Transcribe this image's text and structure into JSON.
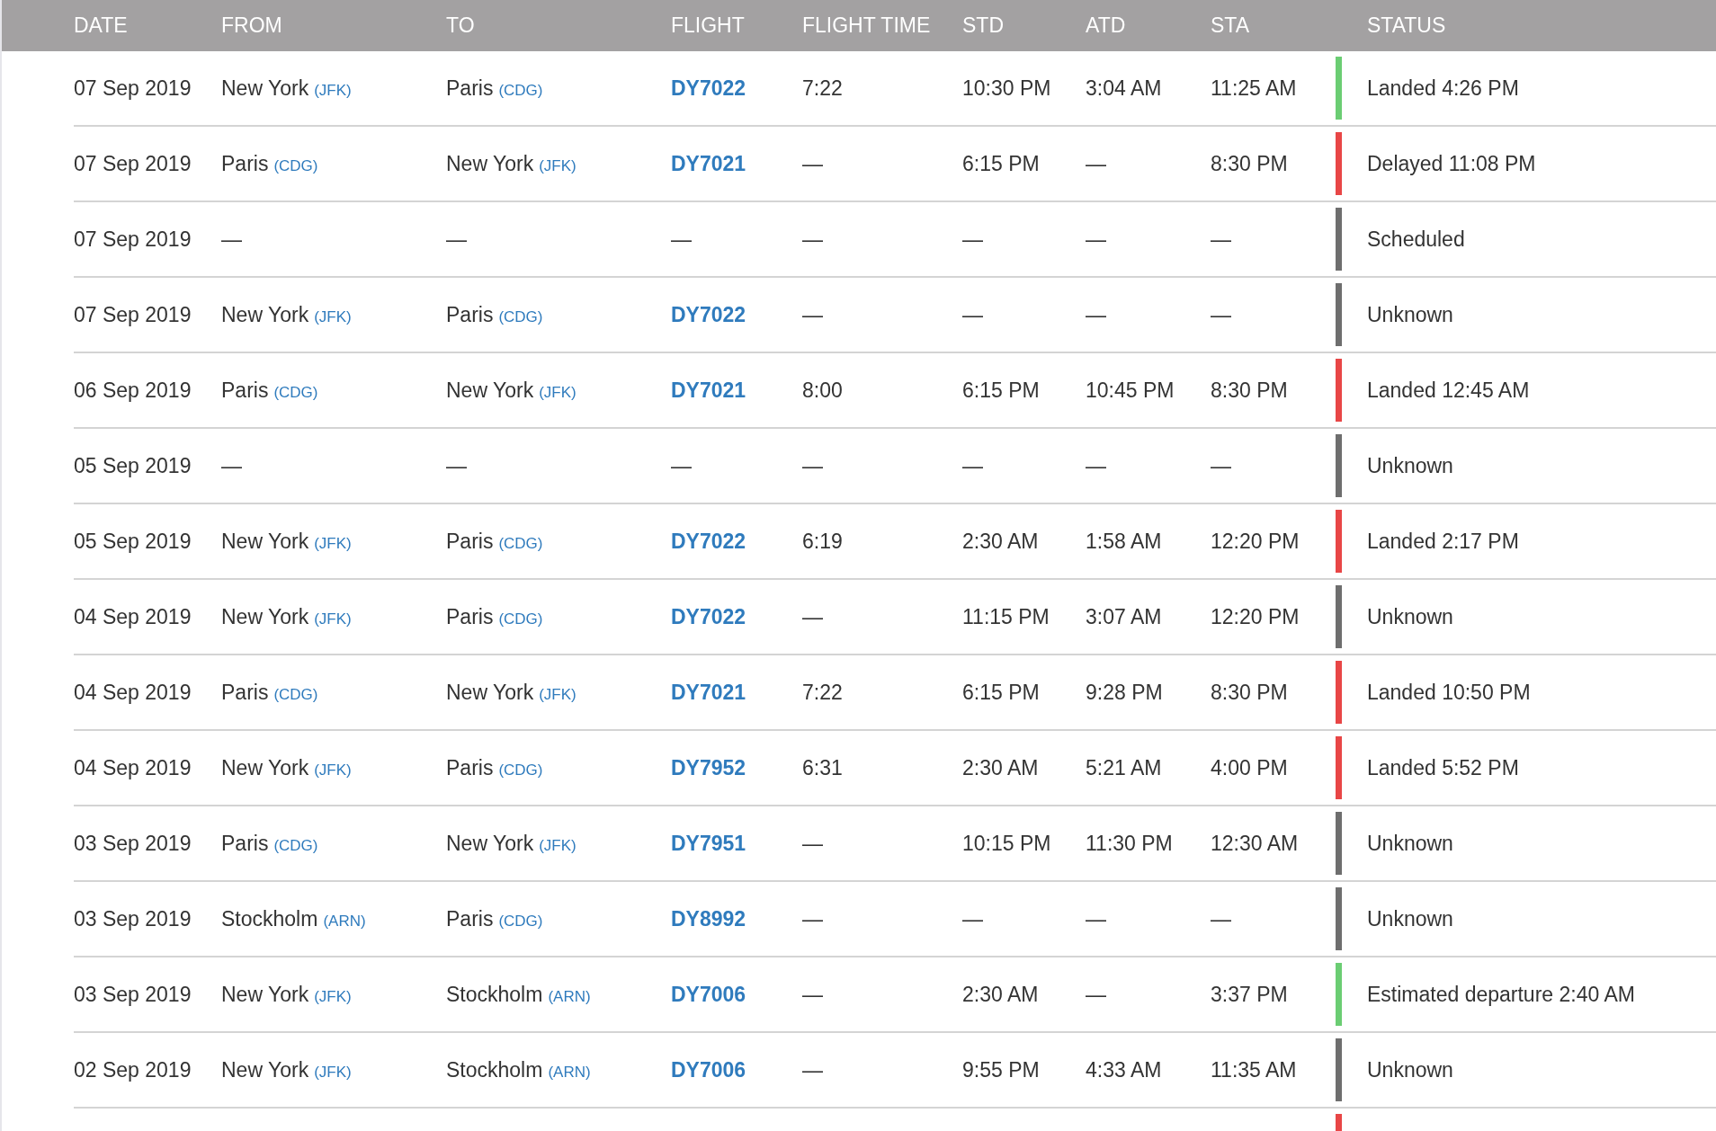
{
  "table": {
    "columns": [
      "DATE",
      "FROM",
      "TO",
      "FLIGHT",
      "FLIGHT TIME",
      "STD",
      "ATD",
      "STA",
      "STATUS"
    ],
    "rows": [
      {
        "date": "07 Sep 2019",
        "from": {
          "city": "New York",
          "code": "(JFK)"
        },
        "to": {
          "city": "Paris",
          "code": "(CDG)"
        },
        "flight": "DY7022",
        "flight_time": "7:22",
        "std": "10:30 PM",
        "atd": "3:04 AM",
        "sta": "11:25 AM",
        "color": "#6bcd73",
        "status": "Landed 4:26 PM"
      },
      {
        "date": "07 Sep 2019",
        "from": {
          "city": "Paris",
          "code": "(CDG)"
        },
        "to": {
          "city": "New York",
          "code": "(JFK)"
        },
        "flight": "DY7021",
        "flight_time": "—",
        "std": "6:15 PM",
        "atd": "—",
        "sta": "8:30 PM",
        "color": "#e84646",
        "status": "Delayed 11:08 PM"
      },
      {
        "date": "07 Sep 2019",
        "from": {
          "city": "—"
        },
        "to": {
          "city": "—"
        },
        "flight": "—",
        "flight_time": "—",
        "std": "—",
        "atd": "—",
        "sta": "—",
        "color": "#6e6e6e",
        "status": "Scheduled"
      },
      {
        "date": "07 Sep 2019",
        "from": {
          "city": "New York",
          "code": "(JFK)"
        },
        "to": {
          "city": "Paris",
          "code": "(CDG)"
        },
        "flight": "DY7022",
        "flight_time": "—",
        "std": "—",
        "atd": "—",
        "sta": "—",
        "color": "#6e6e6e",
        "status": "Unknown"
      },
      {
        "date": "06 Sep 2019",
        "from": {
          "city": "Paris",
          "code": "(CDG)"
        },
        "to": {
          "city": "New York",
          "code": "(JFK)"
        },
        "flight": "DY7021",
        "flight_time": "8:00",
        "std": "6:15 PM",
        "atd": "10:45 PM",
        "sta": "8:30 PM",
        "color": "#e84646",
        "status": "Landed 12:45 AM"
      },
      {
        "date": "05 Sep 2019",
        "from": {
          "city": "—"
        },
        "to": {
          "city": "—"
        },
        "flight": "—",
        "flight_time": "—",
        "std": "—",
        "atd": "—",
        "sta": "—",
        "color": "#6e6e6e",
        "status": "Unknown"
      },
      {
        "date": "05 Sep 2019",
        "from": {
          "city": "New York",
          "code": "(JFK)"
        },
        "to": {
          "city": "Paris",
          "code": "(CDG)"
        },
        "flight": "DY7022",
        "flight_time": "6:19",
        "std": "2:30 AM",
        "atd": "1:58 AM",
        "sta": "12:20 PM",
        "color": "#e84646",
        "status": "Landed 2:17 PM"
      },
      {
        "date": "04 Sep 2019",
        "from": {
          "city": "New York",
          "code": "(JFK)"
        },
        "to": {
          "city": "Paris",
          "code": "(CDG)"
        },
        "flight": "DY7022",
        "flight_time": "—",
        "std": "11:15 PM",
        "atd": "3:07 AM",
        "sta": "12:20 PM",
        "color": "#6e6e6e",
        "status": "Unknown"
      },
      {
        "date": "04 Sep 2019",
        "from": {
          "city": "Paris",
          "code": "(CDG)"
        },
        "to": {
          "city": "New York",
          "code": "(JFK)"
        },
        "flight": "DY7021",
        "flight_time": "7:22",
        "std": "6:15 PM",
        "atd": "9:28 PM",
        "sta": "8:30 PM",
        "color": "#e84646",
        "status": "Landed 10:50 PM"
      },
      {
        "date": "04 Sep 2019",
        "from": {
          "city": "New York",
          "code": "(JFK)"
        },
        "to": {
          "city": "Paris",
          "code": "(CDG)"
        },
        "flight": "DY7952",
        "flight_time": "6:31",
        "std": "2:30 AM",
        "atd": "5:21 AM",
        "sta": "4:00 PM",
        "color": "#e84646",
        "status": "Landed 5:52 PM"
      },
      {
        "date": "03 Sep 2019",
        "from": {
          "city": "Paris",
          "code": "(CDG)"
        },
        "to": {
          "city": "New York",
          "code": "(JFK)"
        },
        "flight": "DY7951",
        "flight_time": "—",
        "std": "10:15 PM",
        "atd": "11:30 PM",
        "sta": "12:30 AM",
        "color": "#6e6e6e",
        "status": "Unknown"
      },
      {
        "date": "03 Sep 2019",
        "from": {
          "city": "Stockholm",
          "code": "(ARN)"
        },
        "to": {
          "city": "Paris",
          "code": "(CDG)"
        },
        "flight": "DY8992",
        "flight_time": "—",
        "std": "—",
        "atd": "—",
        "sta": "—",
        "color": "#6e6e6e",
        "status": "Unknown"
      },
      {
        "date": "03 Sep 2019",
        "from": {
          "city": "New York",
          "code": "(JFK)"
        },
        "to": {
          "city": "Stockholm",
          "code": "(ARN)"
        },
        "flight": "DY7006",
        "flight_time": "—",
        "std": "2:30 AM",
        "atd": "—",
        "sta": "3:37 PM",
        "color": "#6bcd73",
        "status": "Estimated departure 2:40 AM"
      },
      {
        "date": "02 Sep 2019",
        "from": {
          "city": "New York",
          "code": "(JFK)"
        },
        "to": {
          "city": "Stockholm",
          "code": "(ARN)"
        },
        "flight": "DY7006",
        "flight_time": "—",
        "std": "9:55 PM",
        "atd": "4:33 AM",
        "sta": "11:35 AM",
        "color": "#6e6e6e",
        "status": "Unknown"
      },
      {
        "color": "#e84646"
      }
    ]
  }
}
